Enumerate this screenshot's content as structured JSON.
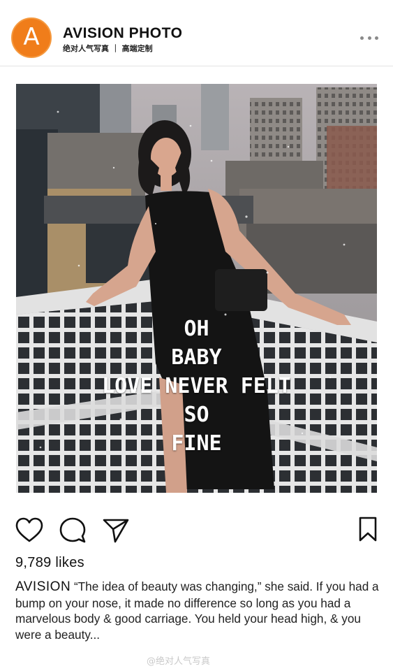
{
  "header": {
    "avatar_letter": "A",
    "brand_name": "AVISION  PHOTO",
    "brand_sub": "绝对人气写真 ｜ 高端定制",
    "more_icon": "ellipsis-icon"
  },
  "photo": {
    "overlay_lines": [
      "OH",
      "BABY",
      "LOVE NEVER FELT",
      "SO",
      "FINE"
    ]
  },
  "actions": {
    "like_icon": "heart-icon",
    "comment_icon": "comment-bubble-icon",
    "share_icon": "paper-plane-icon",
    "bookmark_icon": "bookmark-icon"
  },
  "likes": "9,789 likes",
  "caption": {
    "author": "AVISION",
    "text": "“The idea of beauty was changing,” she said. If you had a bump on your nose, it made no difference so long as you had a marvelous body & good carriage. You held your head high, & you were a beauty..."
  },
  "watermark": "@绝对人气写真",
  "colors": {
    "avatar": "#f07d1a",
    "text": "#222222",
    "divider": "#e3e3e3"
  }
}
